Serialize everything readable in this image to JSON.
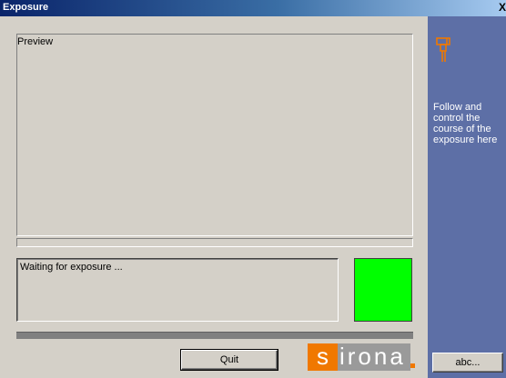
{
  "window": {
    "title": "Exposure",
    "close_glyph": "X"
  },
  "preview": {
    "label": "Preview"
  },
  "status": {
    "message": "Waiting for exposure ...",
    "indicator_color": "#00ff00"
  },
  "buttons": {
    "quit_label": "Quit",
    "abc_label": "abc..."
  },
  "logo": {
    "first_letter": "s",
    "rest": "irona"
  },
  "side_panel": {
    "icon": "xray-unit-icon",
    "help_text": "Follow and control the course of the exposure here",
    "accent_color": "#f07800",
    "background_color": "#5d6fa6"
  }
}
